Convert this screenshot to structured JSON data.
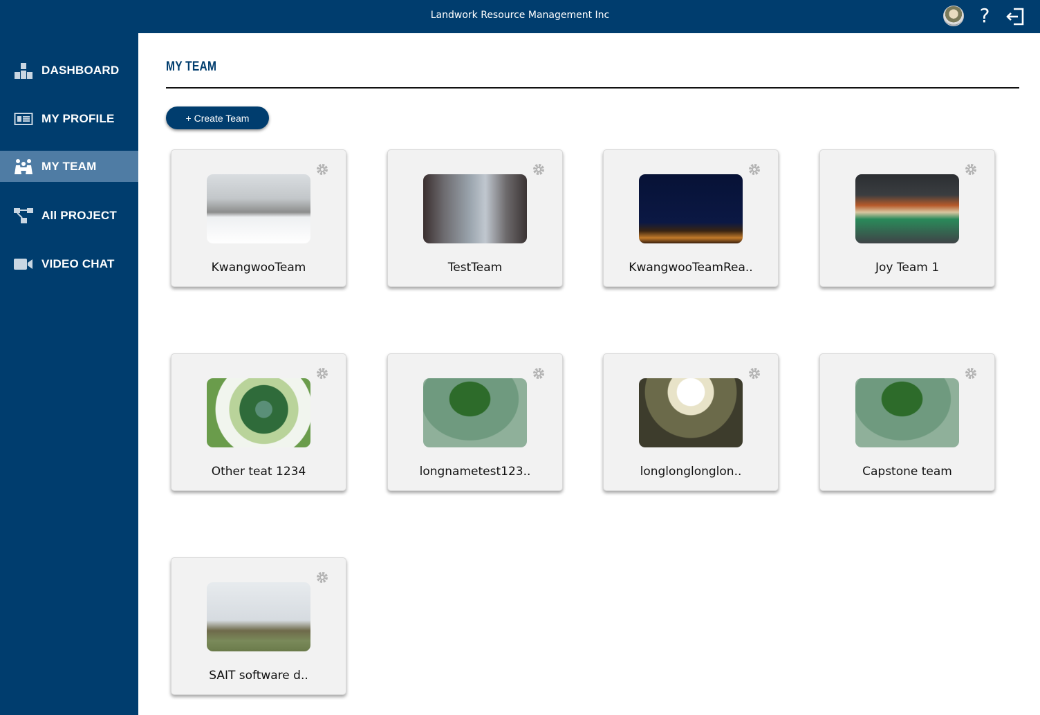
{
  "header": {
    "app_title": "Landwork Resource Management Inc",
    "icons": [
      "user-avatar",
      "help-icon",
      "logout-icon"
    ]
  },
  "sidebar": {
    "items": [
      {
        "label": "DASHBOARD",
        "icon": "dashboard-icon",
        "active": false
      },
      {
        "label": "MY PROFILE",
        "icon": "profile-card-icon",
        "active": false
      },
      {
        "label": "MY TEAM",
        "icon": "team-icon",
        "active": true
      },
      {
        "label": "All PROJECT",
        "icon": "project-icon",
        "active": false
      },
      {
        "label": "VIDEO CHAT",
        "icon": "video-camera-icon",
        "active": false
      }
    ]
  },
  "main": {
    "page_title": "MY TEAM",
    "create_button_label": "+ Create Team",
    "teams": [
      {
        "name": "KwangwooTeam",
        "image": "snowy-road"
      },
      {
        "name": "TestTeam",
        "image": "misty-forest"
      },
      {
        "name": "KwangwooTeamRea..",
        "image": "night-sky"
      },
      {
        "name": "Joy Team 1",
        "image": "shirts-on-hangers"
      },
      {
        "name": "Other teat 1234",
        "image": "terrarium"
      },
      {
        "name": "longnametest123..",
        "image": "leaf-droplet"
      },
      {
        "name": "longlonglonglon..",
        "image": "building-courtyard"
      },
      {
        "name": "Capstone team",
        "image": "leaf-droplet"
      },
      {
        "name": "SAIT software d..",
        "image": "horses-field"
      }
    ]
  },
  "colors": {
    "primary": "#003d6e",
    "sidebar_active": "#4f7ca4",
    "card_background": "#f2f2f2",
    "gear": "#b3b3b3"
  }
}
